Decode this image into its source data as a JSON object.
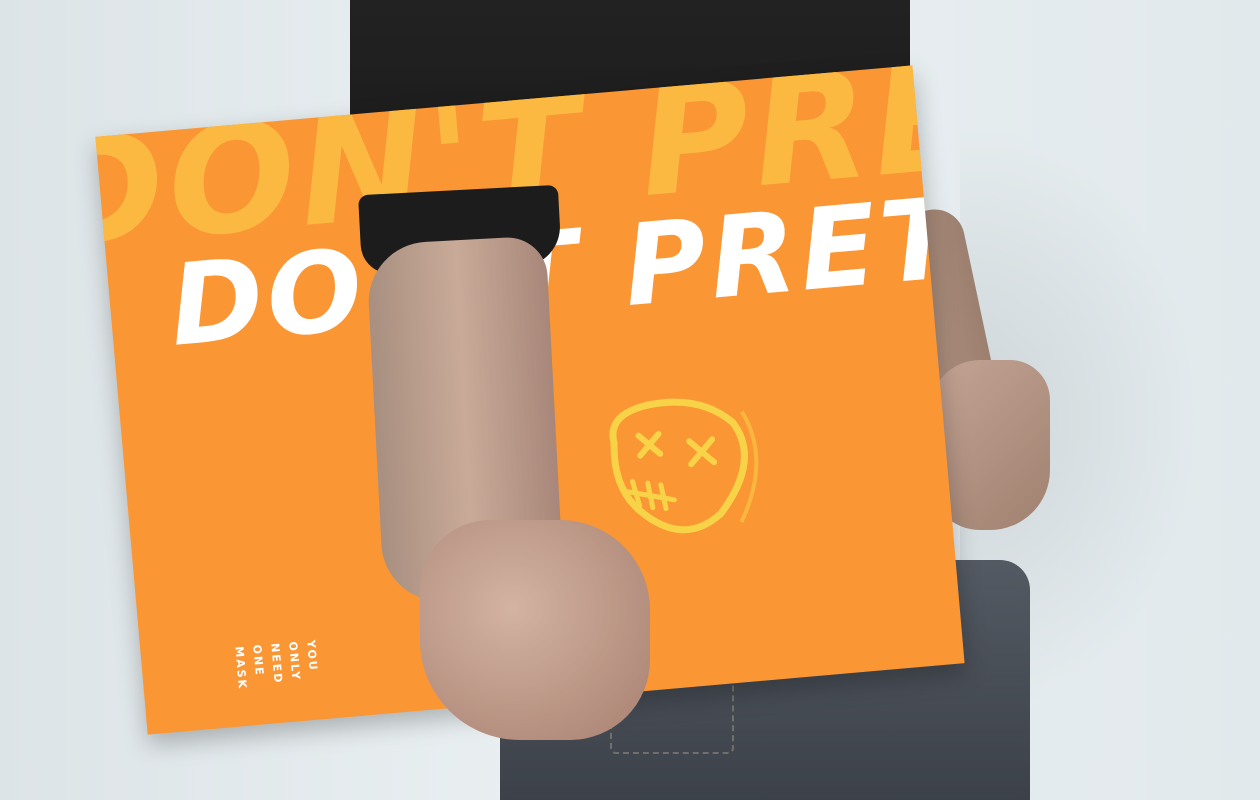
{
  "poster": {
    "headline_background": "DON'T PRETEND",
    "headline_foreground": "DON'T PRETEND",
    "tagline": [
      "YOU",
      "ONLY",
      "NEED",
      "ONE",
      "MASK"
    ]
  },
  "colors": {
    "poster": "#fa9634",
    "headline_shadow": "#fbb941",
    "headline": "#ffffff",
    "mask": "#f9d347"
  }
}
